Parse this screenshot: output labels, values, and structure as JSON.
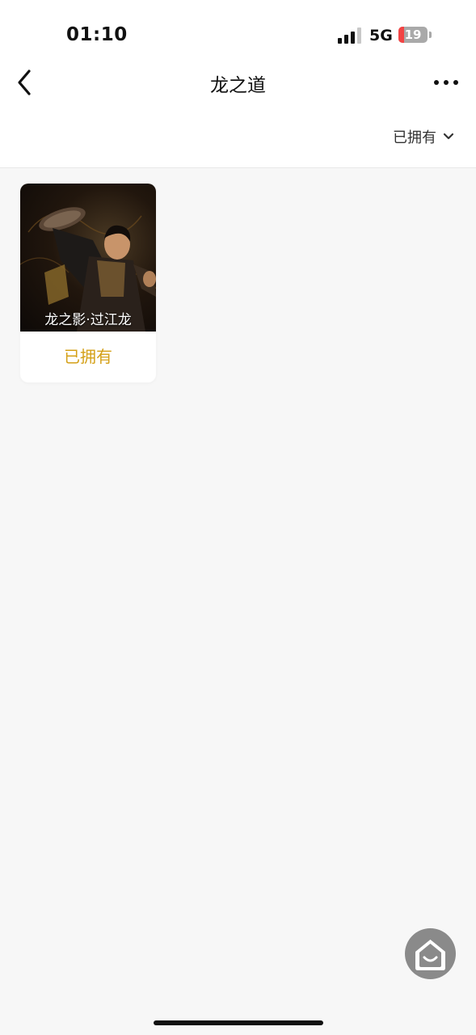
{
  "status_bar": {
    "time": "01:10",
    "network": "5G",
    "battery": "19",
    "battery_level": 0.19
  },
  "nav": {
    "title": "龙之道",
    "back_icon": "chevron-left-icon",
    "more_icon": "more-horizontal-icon"
  },
  "filter": {
    "label": "已拥有",
    "icon": "chevron-down-icon"
  },
  "items": [
    {
      "name": "龙之影·过江龙",
      "status": "已拥有"
    }
  ],
  "colors": {
    "owned_status": "#d4a017",
    "battery_low": "#f24444"
  },
  "fab": {
    "icon": "home-icon"
  }
}
